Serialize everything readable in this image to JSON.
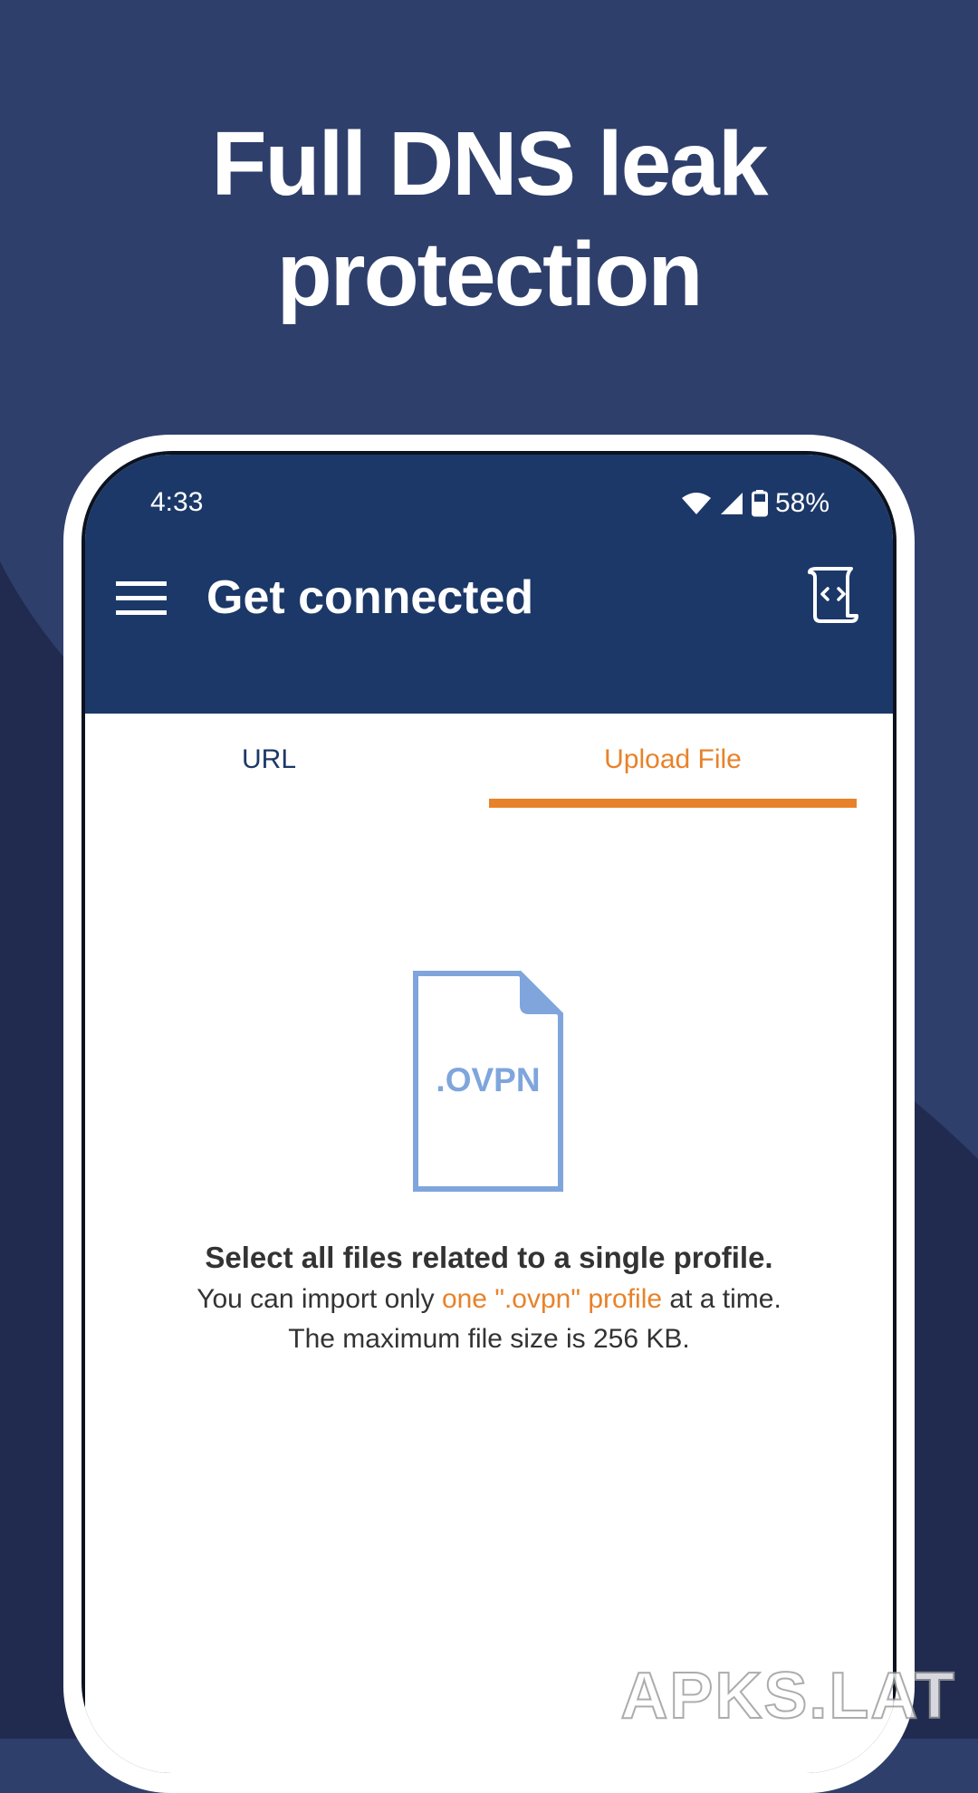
{
  "promo": {
    "headline_line1": "Full DNS leak",
    "headline_line2": "protection"
  },
  "status_bar": {
    "time": "4:33",
    "battery": "58%",
    "icons": [
      "wifi-icon",
      "cell-signal-icon",
      "battery-icon"
    ]
  },
  "app_bar": {
    "title": "Get connected",
    "menu_icon": "hamburger-menu-icon",
    "action_icon": "script-file-icon"
  },
  "tabs": [
    {
      "label": "URL",
      "selected": false
    },
    {
      "label": "Upload File",
      "selected": true
    }
  ],
  "upload": {
    "file_icon_label": ".OVPN",
    "heading": "Select all files related to a single profile.",
    "line2_prefix": "You can import only ",
    "line2_highlight": "one \".ovpn\" profile",
    "line2_suffix": " at a time.",
    "line3": "The maximum file size is 256 KB."
  },
  "watermark": "APKS.LAT",
  "colors": {
    "background": "#2e3f6c",
    "background_dark": "#212b4f",
    "app_bar": "#1c3868",
    "accent": "#e8822a",
    "file_icon": "#7fa5dc",
    "text": "#333333"
  }
}
